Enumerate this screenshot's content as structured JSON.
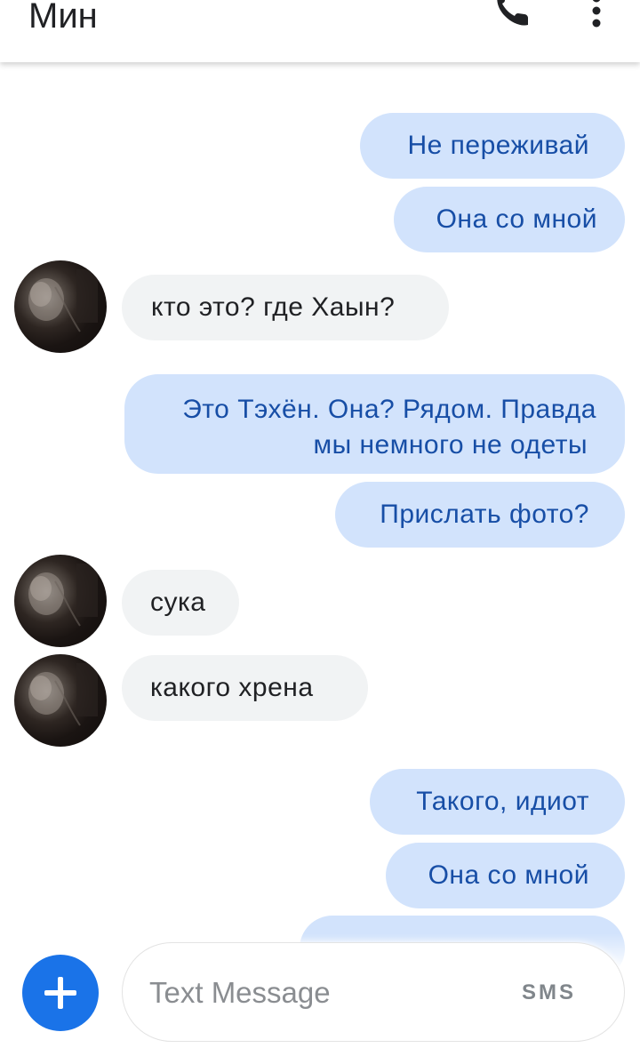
{
  "header": {
    "title": "Мин",
    "call_icon": "phone-icon",
    "menu_icon": "more-vert-icon"
  },
  "messages": [
    {
      "direction": "out",
      "text": "Не переживай"
    },
    {
      "direction": "out",
      "text": "Она со мной"
    },
    {
      "direction": "in",
      "text": "кто это? где Хаын?"
    },
    {
      "direction": "out",
      "lines": [
        "Это Тэхён. Она? Рядом. Правда",
        "мы немного не одеты"
      ]
    },
    {
      "direction": "out",
      "text": "Прислать фото?"
    },
    {
      "direction": "in",
      "text": "сука"
    },
    {
      "direction": "in",
      "text": "какого хрена"
    },
    {
      "direction": "out",
      "text": "Такого, идиот"
    },
    {
      "direction": "out",
      "text": "Она со мной"
    }
  ],
  "composer": {
    "add_icon": "plus-icon",
    "placeholder": "Text Message",
    "sms_label": "SMS"
  },
  "colors": {
    "outgoing_bubble": "#d2e3fc",
    "outgoing_text": "#174ea6",
    "incoming_bubble": "#f1f3f4",
    "incoming_text": "#202124",
    "accent": "#1a73e8"
  }
}
